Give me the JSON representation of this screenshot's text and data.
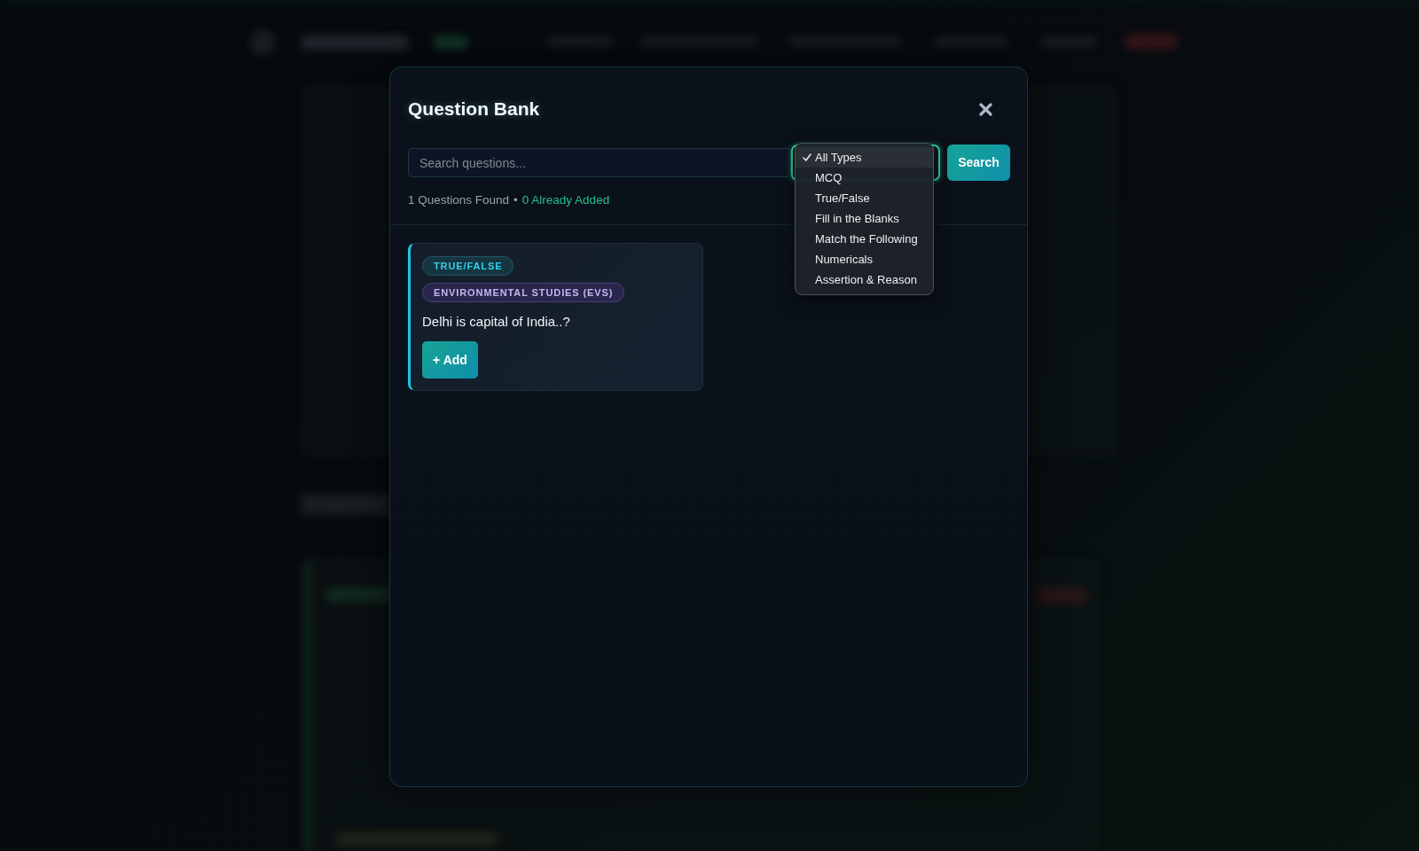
{
  "modal": {
    "title": "Question Bank",
    "search": {
      "placeholder": "Search questions..."
    },
    "type_filter": {
      "expanded": true,
      "options": [
        {
          "label": "All Types",
          "selected": true
        },
        {
          "label": "MCQ",
          "selected": false
        },
        {
          "label": "True/False",
          "selected": false
        },
        {
          "label": "Fill in the Blanks",
          "selected": false
        },
        {
          "label": "Match the Following",
          "selected": false
        },
        {
          "label": "Numericals",
          "selected": false
        },
        {
          "label": "Assertion & Reason",
          "selected": false
        }
      ]
    },
    "search_button": "Search",
    "summary": {
      "found": "1 Questions Found",
      "separator": "•",
      "added": "0 Already Added"
    },
    "questions": [
      {
        "type_badge": "TRUE/FALSE",
        "subject_badge": "ENVIRONMENTAL STUDIES (EVS)",
        "text": "Delhi is capital of India..?",
        "add_button": "+ Add"
      }
    ]
  }
}
